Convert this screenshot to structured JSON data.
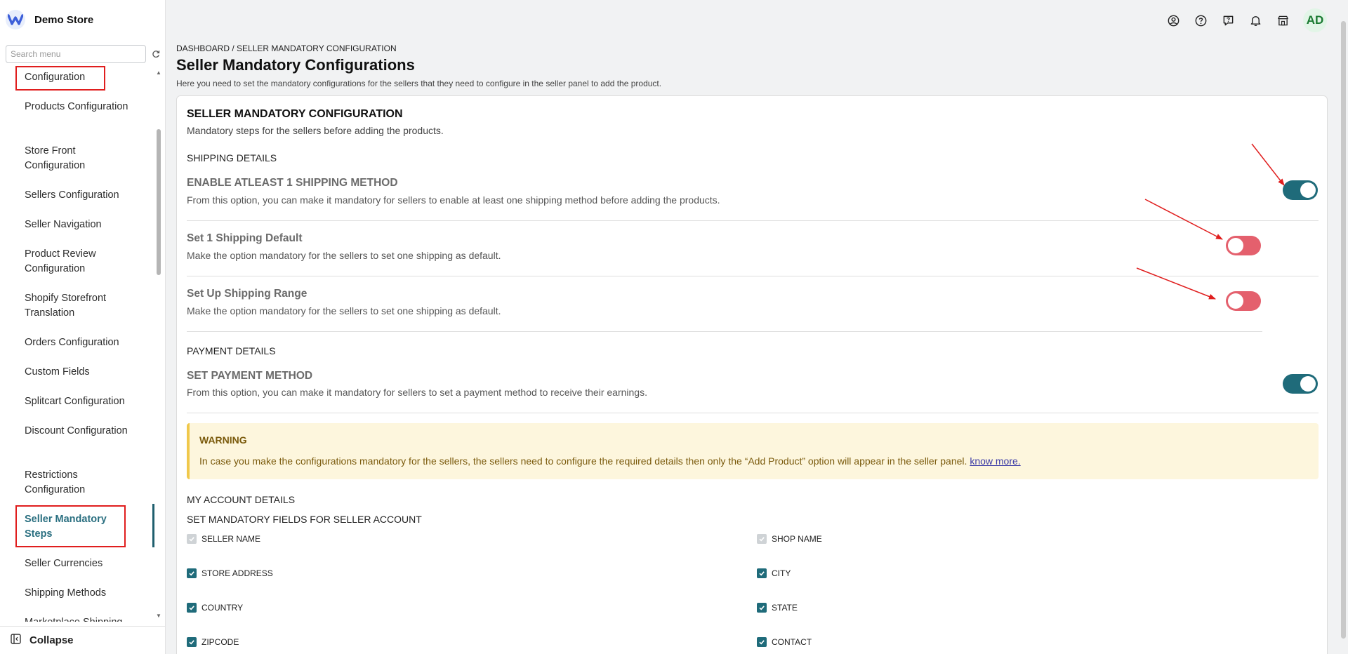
{
  "sidebar": {
    "store_name": "Demo Store",
    "search_placeholder": "Search menu",
    "items": [
      {
        "label": "Configuration"
      },
      {
        "label": "Products Configuration"
      },
      {
        "label": "Store Front Configuration"
      },
      {
        "label": "Sellers Configuration"
      },
      {
        "label": "Seller Navigation"
      },
      {
        "label": "Product Review Configuration"
      },
      {
        "label": "Shopify Storefront Translation"
      },
      {
        "label": "Orders Configuration"
      },
      {
        "label": "Custom Fields"
      },
      {
        "label": "Splitcart Configuration"
      },
      {
        "label": "Discount Configuration"
      },
      {
        "label": "Restrictions Configuration"
      },
      {
        "label": "Seller Mandatory Steps"
      },
      {
        "label": "Seller Currencies"
      },
      {
        "label": "Shipping Methods"
      },
      {
        "label": "Marketplace Shipping"
      }
    ],
    "active_item": "Seller Mandatory Steps",
    "collapse_label": "Collapse"
  },
  "topbar": {
    "icons": [
      "account-icon",
      "help-icon",
      "feedback-icon",
      "notification-icon",
      "store-icon"
    ],
    "avatar_initials": "AD"
  },
  "header": {
    "breadcrumb": "DASHBOARD / SELLER MANDATORY CONFIGURATION",
    "title": "Seller Mandatory Configurations",
    "description": "Here you need to set the mandatory configurations for the sellers that they need to configure in the seller panel to add the product."
  },
  "card": {
    "title": "SELLER MANDATORY CONFIGURATION",
    "subtitle": "Mandatory steps for the sellers before adding the products.",
    "shipping_heading": "SHIPPING DETAILS",
    "options": [
      {
        "title": "ENABLE ATLEAST 1 SHIPPING METHOD",
        "desc": "From this option, you can make it mandatory for sellers to enable at least one shipping method before adding the products.",
        "enabled": true
      },
      {
        "title": "Set 1 Shipping Default",
        "desc": "Make the option mandatory for the sellers to set one shipping as default.",
        "enabled": false
      },
      {
        "title": "Set Up Shipping Range",
        "desc": "Make the option mandatory for the sellers to set one shipping as default.",
        "enabled": false
      }
    ],
    "payment_heading": "PAYMENT DETAILS",
    "payment_option": {
      "title": "SET PAYMENT METHOD",
      "desc": "From this option, you can make it mandatory for sellers to set a payment method to receive their earnings.",
      "enabled": true
    },
    "warning": {
      "title": "WARNING",
      "text": "In case you make the configurations mandatory for the sellers, the sellers need to configure the required details then only the “Add Product” option will appear in the seller panel.",
      "link": "know more."
    },
    "account_heading": "MY ACCOUNT DETAILS",
    "fields_heading": "SET MANDATORY FIELDS FOR SELLER ACCOUNT",
    "fields": [
      {
        "label": "SELLER NAME",
        "checked": true,
        "disabled": true
      },
      {
        "label": "SHOP NAME",
        "checked": true,
        "disabled": true
      },
      {
        "label": "STORE ADDRESS",
        "checked": true,
        "disabled": false
      },
      {
        "label": "CITY",
        "checked": true,
        "disabled": false
      },
      {
        "label": "COUNTRY",
        "checked": true,
        "disabled": false
      },
      {
        "label": "STATE",
        "checked": true,
        "disabled": false
      },
      {
        "label": "ZIPCODE",
        "checked": true,
        "disabled": false
      },
      {
        "label": "CONTACT",
        "checked": true,
        "disabled": false
      }
    ]
  },
  "colors": {
    "toggle_on": "#1f6b7a",
    "toggle_off": "#e4606d",
    "highlight_box": "#e01e1e",
    "annotation_arrow": "#e01e1e"
  }
}
